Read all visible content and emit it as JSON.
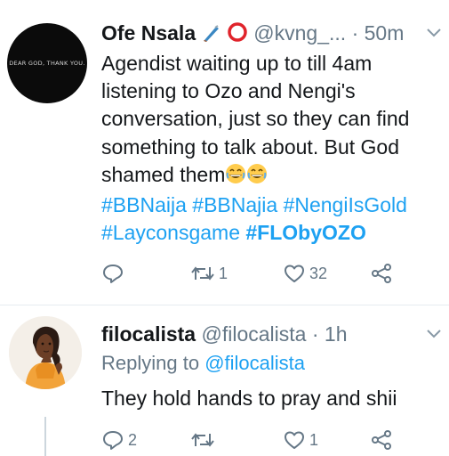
{
  "tweets": [
    {
      "name": "Ofe Nsala",
      "handle": "@kvng_...",
      "separator": "·",
      "time": "50m",
      "avatar_text": "DEAR GOD, THANK YOU.",
      "lines": [
        "Agendist waiting up to till 4am",
        "listening to Ozo and Nengi's",
        "conversation, just so they can find",
        "something to talk about. But God",
        "shamed them"
      ],
      "hashtags_line1": [
        "#BBNaija",
        "#BBNajia",
        "#NengiIsGold"
      ],
      "hashtags_line2": [
        "#Layconsgame",
        "#FLObyOZO"
      ],
      "actions": {
        "reply_count": "",
        "retweet_count": "1",
        "like_count": "32"
      },
      "icons": [
        "knife-emoji-icon",
        "red-circle-emoji-icon",
        "grinning-emoji-icon",
        "grinning-emoji-icon"
      ]
    },
    {
      "name": "filocalista",
      "handle": "@filocalista",
      "separator": "·",
      "time": "1h",
      "replying_to_label": "Replying to",
      "replying_to_handle": "@filocalista",
      "text": "They hold hands to pray and shii",
      "actions": {
        "reply_count": "2",
        "retweet_count": "",
        "like_count": "1"
      }
    }
  ],
  "colors": {
    "accent": "#1da1f2",
    "muted": "#657786",
    "text": "#14171a",
    "divider": "#e6ecf0"
  }
}
